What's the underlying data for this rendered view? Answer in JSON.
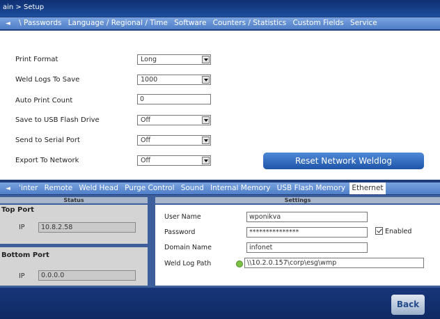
{
  "title_bar": {
    "breadcrumb": "ain > Setup"
  },
  "top_tabs": {
    "arrow": "◄",
    "items": [
      {
        "label": "\\ Passwords"
      },
      {
        "label": "Language / Regional / Time"
      },
      {
        "label": "Software"
      },
      {
        "label": "Counters / Statistics"
      },
      {
        "label": "Custom Fields"
      },
      {
        "label": "Service"
      }
    ]
  },
  "settings": {
    "print_format": {
      "label": "Print Format",
      "value": "Long"
    },
    "weld_logs_to_save": {
      "label": "Weld Logs To Save",
      "value": "1000"
    },
    "auto_print_count": {
      "label": "Auto Print Count",
      "value": "0"
    },
    "save_to_usb": {
      "label": "Save to USB Flash Drive",
      "value": "Off"
    },
    "send_to_serial": {
      "label": "Send to Serial Port",
      "value": "Off"
    },
    "export_to_network": {
      "label": "Export To Network",
      "value": "Off"
    },
    "reset_button": "Reset Network Weldlog"
  },
  "bottom_tabs": {
    "arrow": "◄",
    "items": [
      {
        "label": "'inter"
      },
      {
        "label": "Remote"
      },
      {
        "label": "Weld Head"
      },
      {
        "label": "Purge Control"
      },
      {
        "label": "Sound"
      },
      {
        "label": "Internal Memory"
      },
      {
        "label": "USB Flash Memory"
      },
      {
        "label": "Ethernet"
      }
    ]
  },
  "status": {
    "header": "Status",
    "top_port": {
      "title": "Top Port",
      "ip_label": "IP",
      "ip_value": "10.8.2.58"
    },
    "bottom_port": {
      "title": "Bottom Port",
      "ip_label": "IP",
      "ip_value": "0.0.0.0"
    }
  },
  "network": {
    "header": "Settings",
    "user_name": {
      "label": "User Name",
      "value": "wponikva"
    },
    "password": {
      "label": "Password",
      "value": "***************"
    },
    "enabled_label": "Enabled",
    "domain_name": {
      "label": "Domain Name",
      "value": "infonet"
    },
    "weld_log_path": {
      "label": "Weld Log Path",
      "value": "\\\\10.2.0.157\\corp\\esg\\wmp"
    }
  },
  "footer": {
    "back_label": "Back"
  }
}
